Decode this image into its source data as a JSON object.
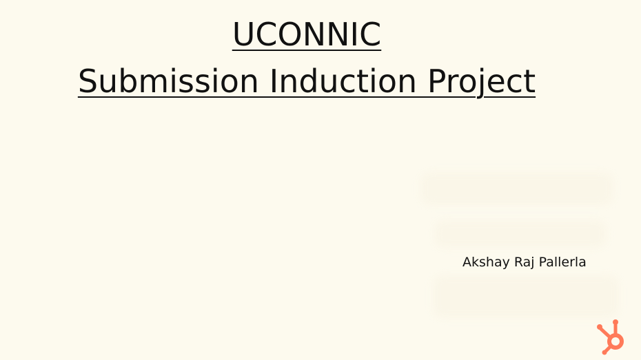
{
  "slide": {
    "title_line1": "UCONNIC",
    "title_line2": "Submission Induction Project",
    "author": "Akshay Raj Pallerla"
  },
  "logo": {
    "icon": "hubspot-logo-icon",
    "color": "#ff7a59"
  },
  "colors": {
    "background": "#fdfaee",
    "text": "#111111"
  }
}
